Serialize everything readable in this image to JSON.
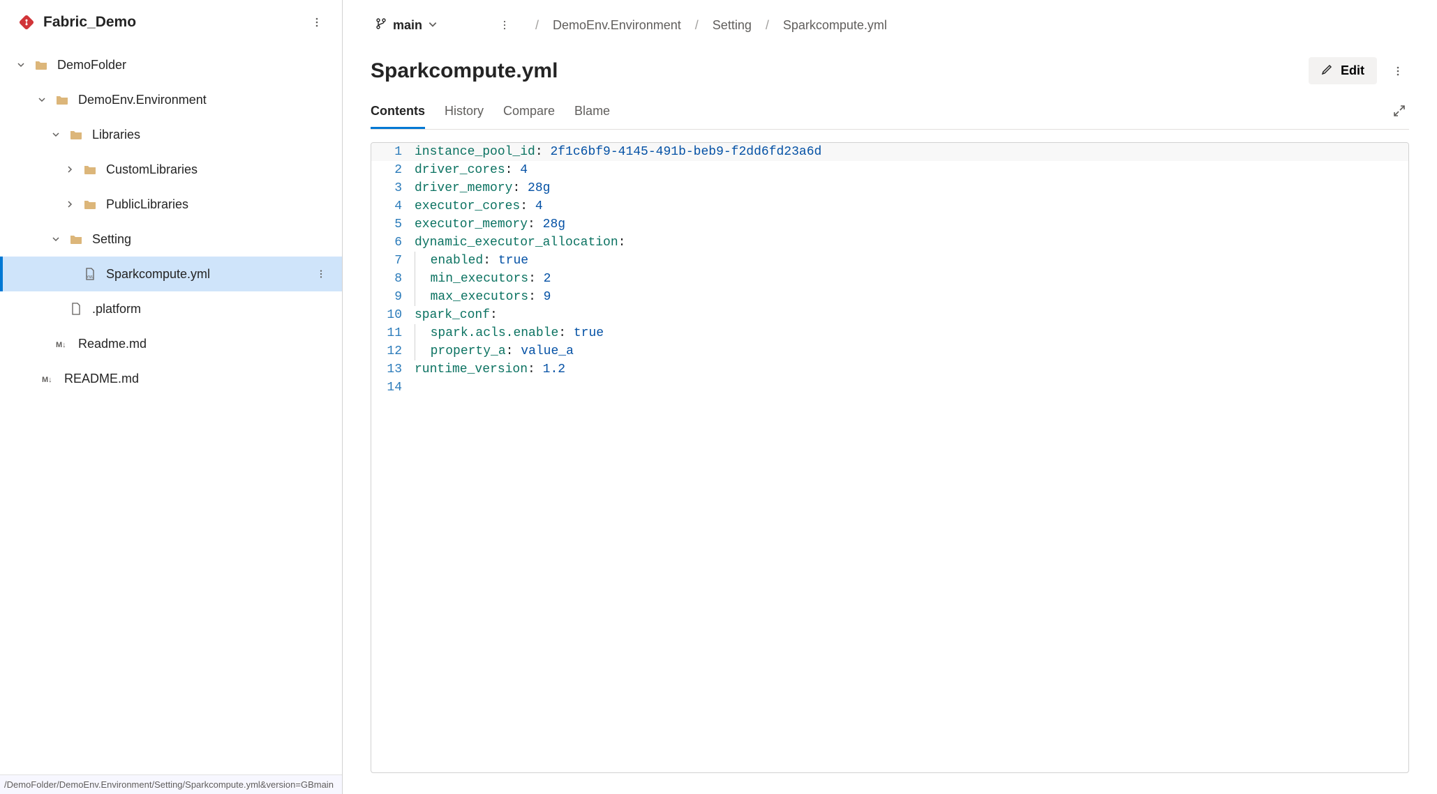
{
  "repo": {
    "name": "Fabric_Demo",
    "branch_label": "main"
  },
  "breadcrumb": {
    "sep": "/",
    "items": [
      "DemoEnv.Environment",
      "Setting",
      "Sparkcompute.yml"
    ]
  },
  "page": {
    "title": "Sparkcompute.yml",
    "edit_label": "Edit"
  },
  "tabs": {
    "contents": "Contents",
    "history": "History",
    "compare": "Compare",
    "blame": "Blame"
  },
  "tree": {
    "demo_folder": "DemoFolder",
    "demo_env": "DemoEnv.Environment",
    "libraries": "Libraries",
    "custom_libraries": "CustomLibraries",
    "public_libraries": "PublicLibraries",
    "setting": "Setting",
    "sparkcompute": "Sparkcompute.yml",
    "platform": ".platform",
    "readme_inner": "Readme.md",
    "readme_root": "README.md"
  },
  "status_bar": "/DemoFolder/DemoEnv.Environment/Setting/Sparkcompute.yml&version=GBmain",
  "code": {
    "lines": [
      {
        "n": "1",
        "key": "instance_pool_id",
        "colon": ": ",
        "val": "2f1c6bf9-4145-491b-beb9-f2dd6fd23a6d",
        "indent": 0,
        "hl": true
      },
      {
        "n": "2",
        "key": "driver_cores",
        "colon": ": ",
        "val": "4",
        "indent": 0
      },
      {
        "n": "3",
        "key": "driver_memory",
        "colon": ": ",
        "val": "28g",
        "indent": 0
      },
      {
        "n": "4",
        "key": "executor_cores",
        "colon": ": ",
        "val": "4",
        "indent": 0
      },
      {
        "n": "5",
        "key": "executor_memory",
        "colon": ": ",
        "val": "28g",
        "indent": 0
      },
      {
        "n": "6",
        "key": "dynamic_executor_allocation",
        "colon": ":",
        "val": "",
        "indent": 0
      },
      {
        "n": "7",
        "key": "enabled",
        "colon": ": ",
        "val": "true",
        "indent": 1
      },
      {
        "n": "8",
        "key": "min_executors",
        "colon": ": ",
        "val": "2",
        "indent": 1
      },
      {
        "n": "9",
        "key": "max_executors",
        "colon": ": ",
        "val": "9",
        "indent": 1
      },
      {
        "n": "10",
        "key": "spark_conf",
        "colon": ":",
        "val": "",
        "indent": 0
      },
      {
        "n": "11",
        "key": "spark.acls.enable",
        "colon": ": ",
        "val": "true",
        "indent": 1
      },
      {
        "n": "12",
        "key": "property_a",
        "colon": ": ",
        "val": "value_a",
        "indent": 1
      },
      {
        "n": "13",
        "key": "runtime_version",
        "colon": ": ",
        "val": "1.2",
        "indent": 0
      },
      {
        "n": "14",
        "key": "",
        "colon": "",
        "val": "",
        "indent": 0
      }
    ]
  }
}
